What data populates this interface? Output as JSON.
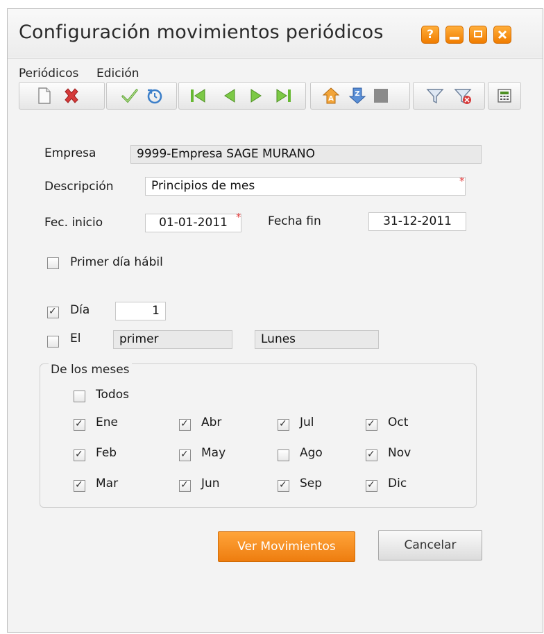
{
  "window": {
    "title": "Configuración movimientos periódicos",
    "help_label": "?"
  },
  "menu": {
    "items": [
      "Periódicos",
      "Edición"
    ]
  },
  "toolbar": {
    "icons": [
      "new-document-icon",
      "delete-icon",
      "accept-icon",
      "undo-icon",
      "first-record-icon",
      "previous-record-icon",
      "next-record-icon",
      "last-record-icon",
      "sort-ascending-icon",
      "sort-descending-icon",
      "stop-icon",
      "filter-icon",
      "remove-filter-icon",
      "calculator-icon"
    ]
  },
  "form": {
    "empresa_label": "Empresa",
    "empresa_value": "9999-Empresa SAGE MURANO",
    "descripcion_label": "Descripción",
    "descripcion_value": "Principios de mes",
    "fec_inicio_label": "Fec. inicio",
    "fec_inicio_value": "01-01-2011",
    "fecha_fin_label": "Fecha fin",
    "fecha_fin_value": "31-12-2011",
    "required_mark": "*",
    "primer_dia_habil_label": "Primer día hábil",
    "primer_dia_habil_checked": false,
    "dia_label": "Día",
    "dia_checked": true,
    "dia_value": "1",
    "el_label": "El",
    "el_checked": false,
    "el_ordinal": "primer",
    "el_weekday": "Lunes"
  },
  "months_group": {
    "title": "De los meses",
    "todos_label": "Todos",
    "todos_checked": false,
    "months": [
      {
        "label": "Ene",
        "checked": true
      },
      {
        "label": "Feb",
        "checked": true
      },
      {
        "label": "Mar",
        "checked": true
      },
      {
        "label": "Abr",
        "checked": true
      },
      {
        "label": "May",
        "checked": true
      },
      {
        "label": "Jun",
        "checked": true
      },
      {
        "label": "Jul",
        "checked": true
      },
      {
        "label": "Ago",
        "checked": false
      },
      {
        "label": "Sep",
        "checked": true
      },
      {
        "label": "Oct",
        "checked": true
      },
      {
        "label": "Nov",
        "checked": true
      },
      {
        "label": "Dic",
        "checked": true
      }
    ]
  },
  "buttons": {
    "ver_movimientos": "Ver Movimientos",
    "cancelar": "Cancelar"
  },
  "colors": {
    "accent": "#f28c1e",
    "required": "#e23b3b"
  }
}
